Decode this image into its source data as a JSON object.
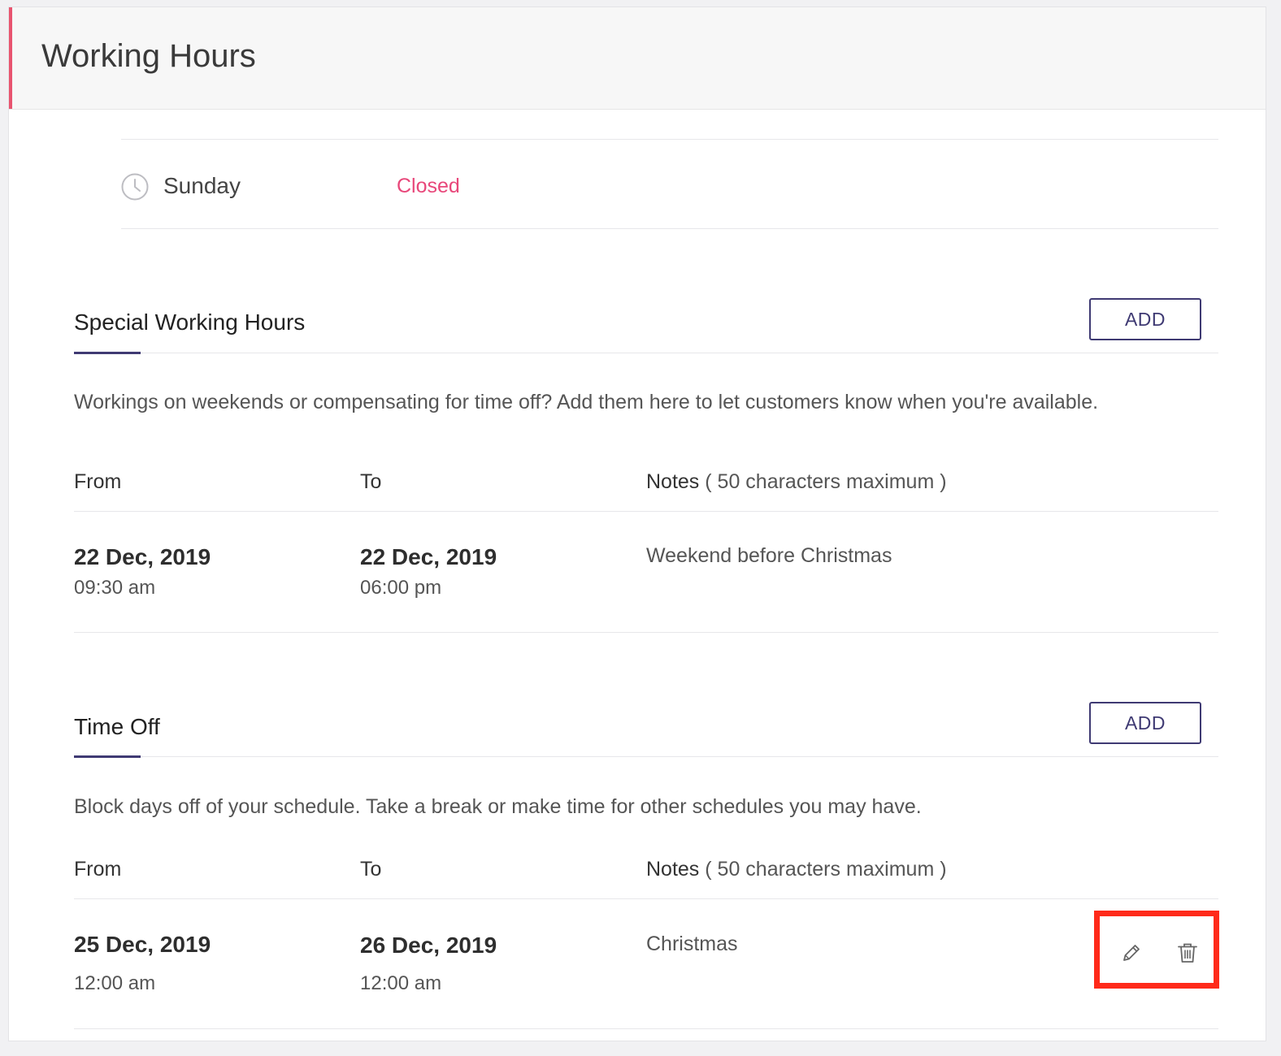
{
  "header": {
    "title": "Working Hours"
  },
  "weekday": {
    "day": "Sunday",
    "status": "Closed"
  },
  "special": {
    "title": "Special Working Hours",
    "add_label": "ADD",
    "description": "Workings on weekends or compensating for time off? Add them here to let customers know when you're available.",
    "columns": {
      "from": "From",
      "to": "To",
      "notes": "Notes",
      "notes_hint": "( 50 characters maximum )"
    },
    "rows": [
      {
        "from_date": "22 Dec, 2019",
        "from_time": "09:30 am",
        "to_date": "22 Dec, 2019",
        "to_time": "06:00 pm",
        "note": "Weekend before Christmas"
      }
    ]
  },
  "timeoff": {
    "title": "Time Off",
    "add_label": "ADD",
    "description": "Block days off of your schedule. Take a break or make time for other schedules you may have.",
    "columns": {
      "from": "From",
      "to": "To",
      "notes": "Notes",
      "notes_hint": "( 50 characters maximum )"
    },
    "rows": [
      {
        "from_date": "25 Dec, 2019",
        "from_time": "12:00 am",
        "to_date": "26 Dec, 2019",
        "to_time": "12:00 am",
        "note": "Christmas"
      }
    ],
    "row_actions": [
      "pencil-icon",
      "trash-icon"
    ]
  },
  "colors": {
    "accent": "#e8546f",
    "closed": "#e8477a",
    "brand": "#3f3a73",
    "highlight": "#ff2a1a"
  }
}
